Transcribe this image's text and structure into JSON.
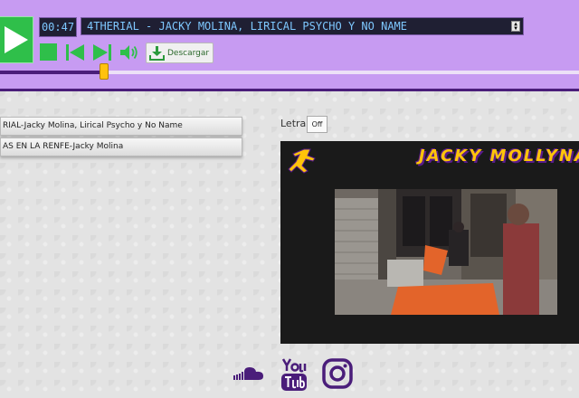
{
  "player": {
    "time": "00:47",
    "current_track": "4THERIAL - JACKY MOLINA, LIRICAL PSYCHO Y NO NAME",
    "download_label": "Descargar",
    "progress_fraction": 0.18
  },
  "playlist": {
    "items": [
      {
        "label": "RIAL-Jacky Molina, Lirical Psycho y No Name"
      },
      {
        "label": "AS EN LA RENFE-Jacky Molina"
      }
    ]
  },
  "lyrics": {
    "label": "Letra",
    "toggle": "Off"
  },
  "video": {
    "brand_text": "JACKY MOLLYNA"
  },
  "colors": {
    "player_bg": "#c79bf2",
    "accent_green": "#2fbf4a",
    "accent_purple": "#4a1d7a",
    "thumb_yellow": "#ffc20e",
    "brand_yellow": "#ffc40a"
  },
  "social": [
    {
      "icon": "soundcloud-icon"
    },
    {
      "icon": "youtube-icon"
    },
    {
      "icon": "instagram-icon"
    }
  ]
}
